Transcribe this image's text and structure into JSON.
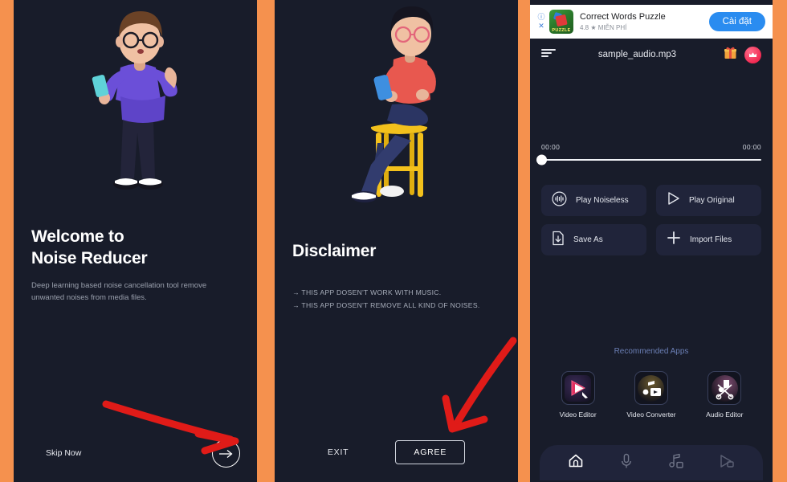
{
  "theme": {
    "separator_orange": "#f5914e",
    "panel_background": "#181c2a",
    "card_background": "#20243a",
    "accent_blue": "#2a8cf0",
    "annotation_red": "#e01b18",
    "recommended_heading": "#6b7fb5"
  },
  "panel_one": {
    "name": "onboarding-welcome",
    "title_line1": "Welcome to",
    "title_line2": "Noise Reducer",
    "subtitle": "Deep learning based noise cancellation tool remove unwanted noises from media files.",
    "skip_label": "Skip Now",
    "next_icon": "arrow-right-icon",
    "illustration": "person-standing-holding-phone"
  },
  "panel_two": {
    "name": "disclaimer-screen",
    "title": "Disclaimer",
    "lines": [
      "→ THIS APP DOSEN'T WORK WITH MUSIC.",
      "→ THIS APP DOSEN'T REMOVE ALL KIND OF NOISES."
    ],
    "exit_label": "EXIT",
    "agree_label": "AGREE",
    "illustration": "person-sitting-on-stool-with-phone"
  },
  "panel_three": {
    "name": "player-screen",
    "ad": {
      "app_name": "Correct Words Puzzle",
      "rating": "4.8",
      "star": "★",
      "price_label": "MIỄN PHÍ",
      "cta_label": "Cài đặt",
      "info_icon": "info-icon",
      "close_icon": "close-icon",
      "icon_text": "PUZZLE"
    },
    "header": {
      "menu_icon": "hamburger-menu-icon",
      "file_name": "sample_audio.mp3",
      "gift_icon": "gift-icon",
      "premium_icon": "crown-icon"
    },
    "seek": {
      "current_time": "00:00",
      "total_time": "00:00",
      "progress_percent": 0
    },
    "actions": [
      {
        "label": "Play Noiseless",
        "icon": "waveform-circle-icon"
      },
      {
        "label": "Play Original",
        "icon": "play-triangle-icon"
      },
      {
        "label": "Save As",
        "icon": "file-download-icon"
      },
      {
        "label": "Import Files",
        "icon": "plus-icon"
      }
    ],
    "recommended": {
      "heading": "Recommended Apps",
      "apps": [
        {
          "label": "Video Editor",
          "icon": "video-editor-app-icon"
        },
        {
          "label": "Video Converter",
          "icon": "video-converter-app-icon"
        },
        {
          "label": "Audio Editor",
          "icon": "audio-editor-app-icon"
        }
      ]
    },
    "bottom_nav": [
      {
        "icon": "home-icon",
        "active": true
      },
      {
        "icon": "microphone-icon",
        "active": false
      },
      {
        "icon": "music-note-icon",
        "active": false
      },
      {
        "icon": "video-icon",
        "active": false
      }
    ]
  },
  "annotations": [
    {
      "name": "arrow-to-next-button",
      "target": "next-circle-button"
    },
    {
      "name": "arrow-to-agree-button",
      "target": "agree-button"
    }
  ]
}
